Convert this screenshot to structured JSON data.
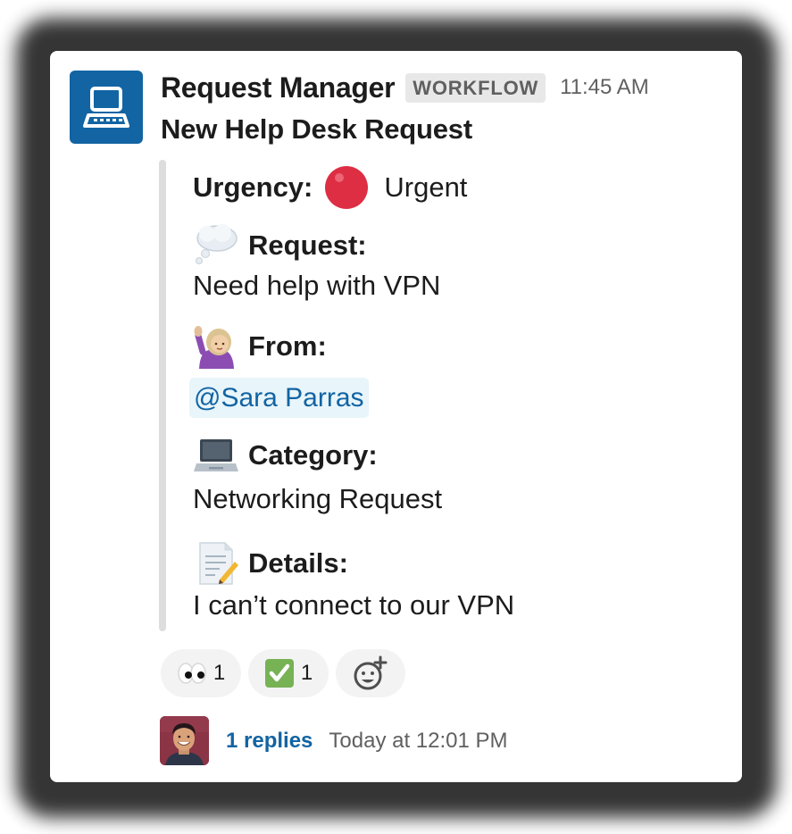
{
  "message": {
    "sender": "Request Manager",
    "tag": "WORKFLOW",
    "timestamp": "11:45 AM",
    "title": "New Help Desk Request"
  },
  "fields": [
    {
      "icon": "red-circle-icon",
      "label": "Urgency:",
      "value": "Urgent"
    },
    {
      "icon": "thought-balloon-icon",
      "label": "Request:",
      "value": "Need help with VPN"
    },
    {
      "icon": "person-raising-hand-icon",
      "label": "From:",
      "value": "@Sara Parras"
    },
    {
      "icon": "laptop-icon",
      "label": "Category:",
      "value": "Networking Request"
    },
    {
      "icon": "memo-icon",
      "label": "Details:",
      "value": "I can’t connect to our VPN"
    }
  ],
  "reactions": [
    {
      "icon": "eyes-icon",
      "count": "1"
    },
    {
      "icon": "check-mark-icon",
      "count": "1"
    },
    {
      "icon": "add-reaction-icon",
      "count": ""
    }
  ],
  "thread": {
    "replies": "1 replies",
    "time": "Today at 12:01 PM"
  },
  "colors": {
    "brand_blue": "#1264a3",
    "urgent_red": "#dd2e44",
    "check_green": "#77b255",
    "mention_bg": "#e8f5fa",
    "bar_gray": "#dddddd"
  }
}
